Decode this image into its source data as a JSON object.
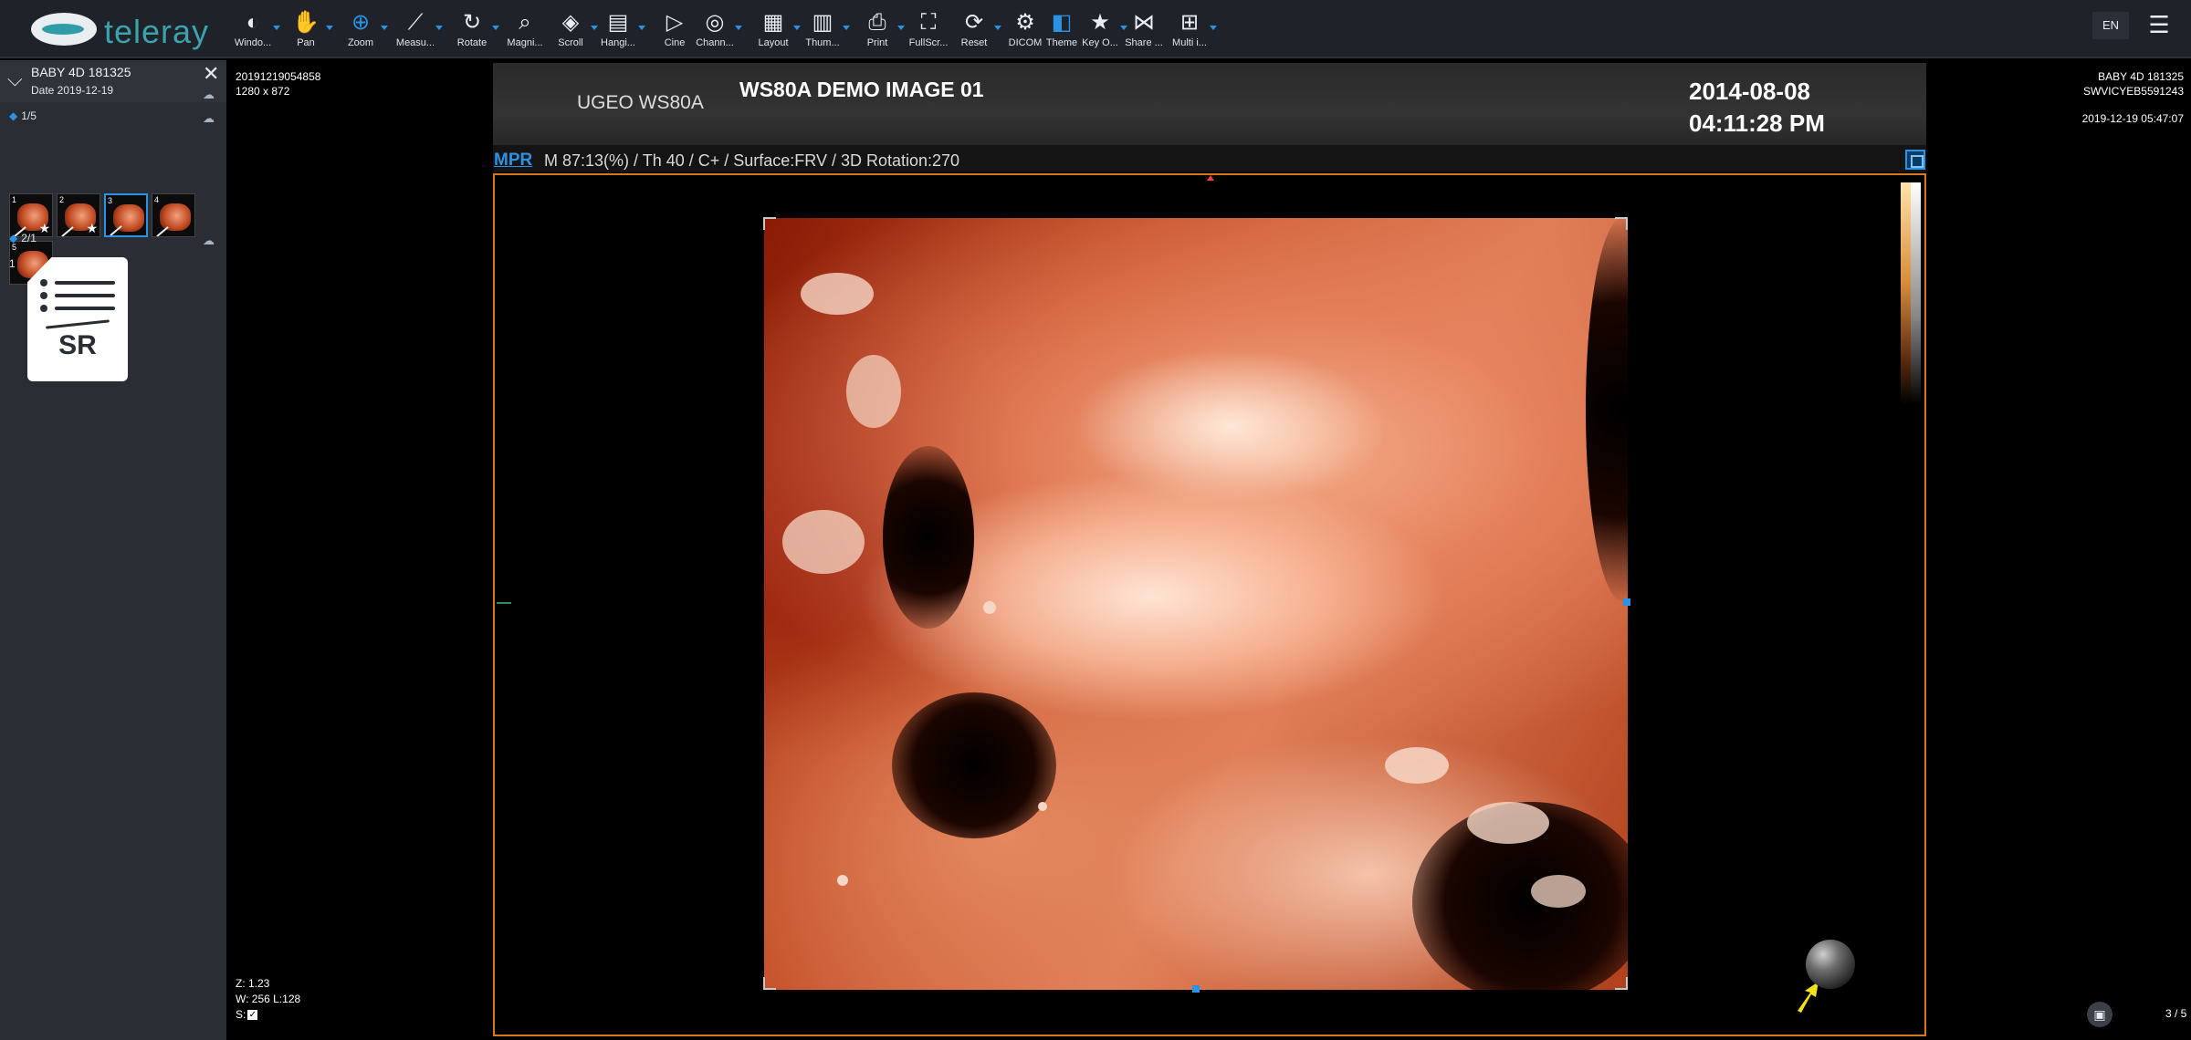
{
  "app": {
    "logo_text": "teleray",
    "language": "EN"
  },
  "toolbar": {
    "items": [
      {
        "label": "Windo...",
        "icon": "contrast-icon",
        "caret": true
      },
      {
        "label": "Pan",
        "icon": "hand-icon",
        "caret": true
      },
      {
        "label": "Zoom",
        "icon": "zoom-icon",
        "caret": true
      },
      {
        "label": "Measu...",
        "icon": "ruler-icon",
        "caret": true
      },
      {
        "label": "Rotate",
        "icon": "rotate-icon",
        "caret": true
      },
      {
        "label": "Magni...",
        "icon": "magnifier-icon",
        "caret": false
      },
      {
        "label": "Scroll",
        "icon": "layers-icon",
        "caret": true
      },
      {
        "label": "Hangi...",
        "icon": "hanging-protocol-icon",
        "caret": true
      },
      {
        "label": "Cine",
        "icon": "play-icon",
        "caret": false
      },
      {
        "label": "Chann...",
        "icon": "channels-icon",
        "caret": true
      },
      {
        "label": "Layout",
        "icon": "grid-icon",
        "caret": true
      },
      {
        "label": "Thum...",
        "icon": "thumbnails-icon",
        "caret": true
      },
      {
        "label": "Print",
        "icon": "print-icon",
        "caret": true
      },
      {
        "label": "FullScr...",
        "icon": "fullscreen-icon",
        "caret": false
      },
      {
        "label": "Reset",
        "icon": "reset-icon",
        "caret": true
      },
      {
        "label": "DICOM",
        "icon": "gear-icon",
        "caret": false
      },
      {
        "label": "Theme",
        "icon": "theme-icon",
        "caret": false
      },
      {
        "label": "Key O...",
        "icon": "star-icon",
        "caret": true
      },
      {
        "label": "Share ...",
        "icon": "share-icon",
        "caret": false
      },
      {
        "label": "Multi i...",
        "icon": "multi-image-icon",
        "caret": true
      }
    ]
  },
  "sidebar": {
    "study_title": "BABY 4D 181325",
    "study_date": "Date 2019-12-19",
    "series": [
      {
        "label": "1/5",
        "thumbnails": [
          {
            "num": "1",
            "starred": true,
            "selected": false
          },
          {
            "num": "2",
            "starred": true,
            "selected": false
          },
          {
            "num": "3",
            "starred": false,
            "selected": true
          },
          {
            "num": "4",
            "starred": false,
            "selected": false
          },
          {
            "num": "5",
            "starred": false,
            "selected": false
          }
        ]
      },
      {
        "label": "2/1",
        "report_num": "1",
        "report_text": "SR"
      }
    ]
  },
  "viewer": {
    "top_left": {
      "id": "20191219054858",
      "size": "1280 x 872"
    },
    "top_right": {
      "name": "BABY 4D 181325",
      "patient_id": "SWVICYEB5591243",
      "datetime": "2019-12-19 05:47:07"
    },
    "banner": {
      "machine": "UGEO WS80A",
      "title": "WS80A DEMO IMAGE 01",
      "date": "2014-08-08",
      "time": "04:11:28 PM"
    },
    "info": {
      "mode": "MPR",
      "params": "M 87:13(%) / Th 40 / C+ / Surface:FRV / 3D Rotation:270"
    },
    "bottom_left": {
      "zoom": "Z: 1.23",
      "window": "W: 256 L:128",
      "s_label": "S:",
      "s_checked": true
    },
    "pager": "3 / 5",
    "colors": {
      "accent": "#2b93e6",
      "frame": "#d47a1e"
    }
  }
}
